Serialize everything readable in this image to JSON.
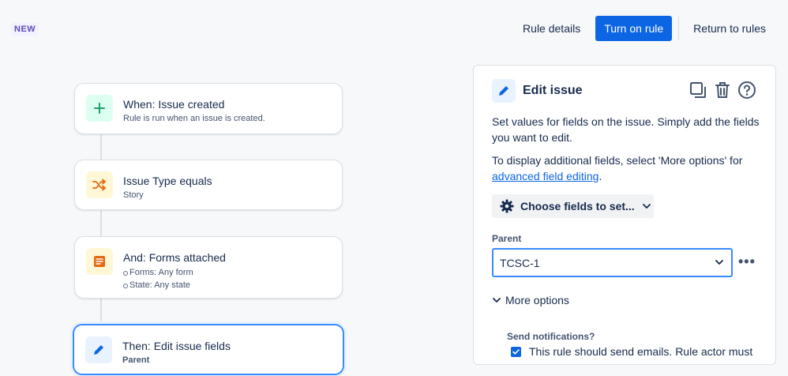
{
  "badge": "NEW",
  "header": {
    "rule_details": "Rule details",
    "turn_on_rule": "Turn on rule",
    "return_to_rules": "Return to rules"
  },
  "flow": {
    "trigger": {
      "title": "When: Issue created",
      "subtitle": "Rule is run when an issue is created."
    },
    "condition1": {
      "title": "Issue Type equals",
      "subtitle": "Story"
    },
    "condition2": {
      "title": "And: Forms attached",
      "items": [
        "Forms: Any form",
        "State: Any state"
      ]
    },
    "action": {
      "title": "Then: Edit issue fields",
      "subtitle": "Parent"
    }
  },
  "panel": {
    "title": "Edit issue",
    "description": "Set values for fields on the issue. Simply add the fields you want to edit.",
    "display_prefix": "To display additional fields, select 'More options' for",
    "display_link": "advanced field editing",
    "display_suffix": ".",
    "choose_fields": "Choose fields to set...",
    "parent_label": "Parent",
    "parent_value": "TCSC-1",
    "more_dots": "•••",
    "more_options": "More options",
    "send_notifications_label": "Send notifications?",
    "send_notifications_text": "This rule should send emails. Rule actor must"
  },
  "colors": {
    "primary": "#0c66e4",
    "trigger_icon_bg": "#dcfff1",
    "trigger_icon": "#22a06b",
    "condition_icon_bg": "#fff7d6",
    "condition_icon": "#e56910",
    "action_icon_bg": "#e9f2ff",
    "action_icon": "#0c66e4"
  },
  "icons": {
    "trigger": "plus-icon",
    "condition1": "shuffle-icon",
    "condition2": "form-icon",
    "action": "pencil-icon"
  }
}
